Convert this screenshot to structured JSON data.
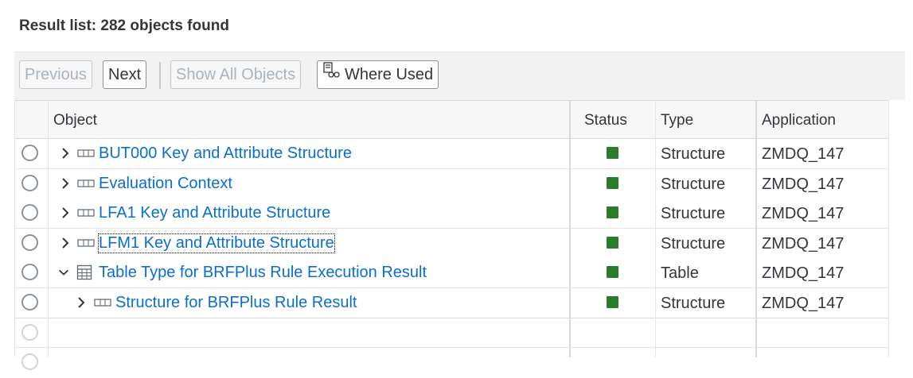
{
  "header": {
    "title": "Result list: 282  objects found"
  },
  "toolbar": {
    "previous_label": "Previous",
    "next_label": "Next",
    "show_all_label": "Show All Objects",
    "where_used_label": "Where Used"
  },
  "table": {
    "columns": {
      "object": "Object",
      "status": "Status",
      "type": "Type",
      "application": "Application"
    },
    "rows": [
      {
        "name": "BUT000 Key and Attribute Structure",
        "type": "Structure",
        "application": "ZMDQ_147",
        "status": "active",
        "expanded": false,
        "icon": "structure-icon"
      },
      {
        "name": "Evaluation Context",
        "type": "Structure",
        "application": "ZMDQ_147",
        "status": "active",
        "expanded": false,
        "icon": "structure-icon"
      },
      {
        "name": "LFA1 Key and Attribute Structure",
        "type": "Structure",
        "application": "ZMDQ_147",
        "status": "active",
        "expanded": false,
        "icon": "structure-icon"
      },
      {
        "name": "LFM1 Key and Attribute Structure",
        "type": "Structure",
        "application": "ZMDQ_147",
        "status": "active",
        "expanded": false,
        "icon": "structure-icon"
      },
      {
        "name": "Table Type for BRFPlus Rule Execution Result",
        "type": "Table",
        "application": "ZMDQ_147",
        "status": "active",
        "expanded": true,
        "icon": "table-icon"
      },
      {
        "name": "Structure for BRFPlus Rule Result",
        "type": "Structure",
        "application": "ZMDQ_147",
        "status": "active",
        "expanded": false,
        "icon": "structure-icon"
      }
    ]
  },
  "colors": {
    "link": "#0a6ed1",
    "status_active": "#2b7d2b",
    "text": "#32363a"
  }
}
